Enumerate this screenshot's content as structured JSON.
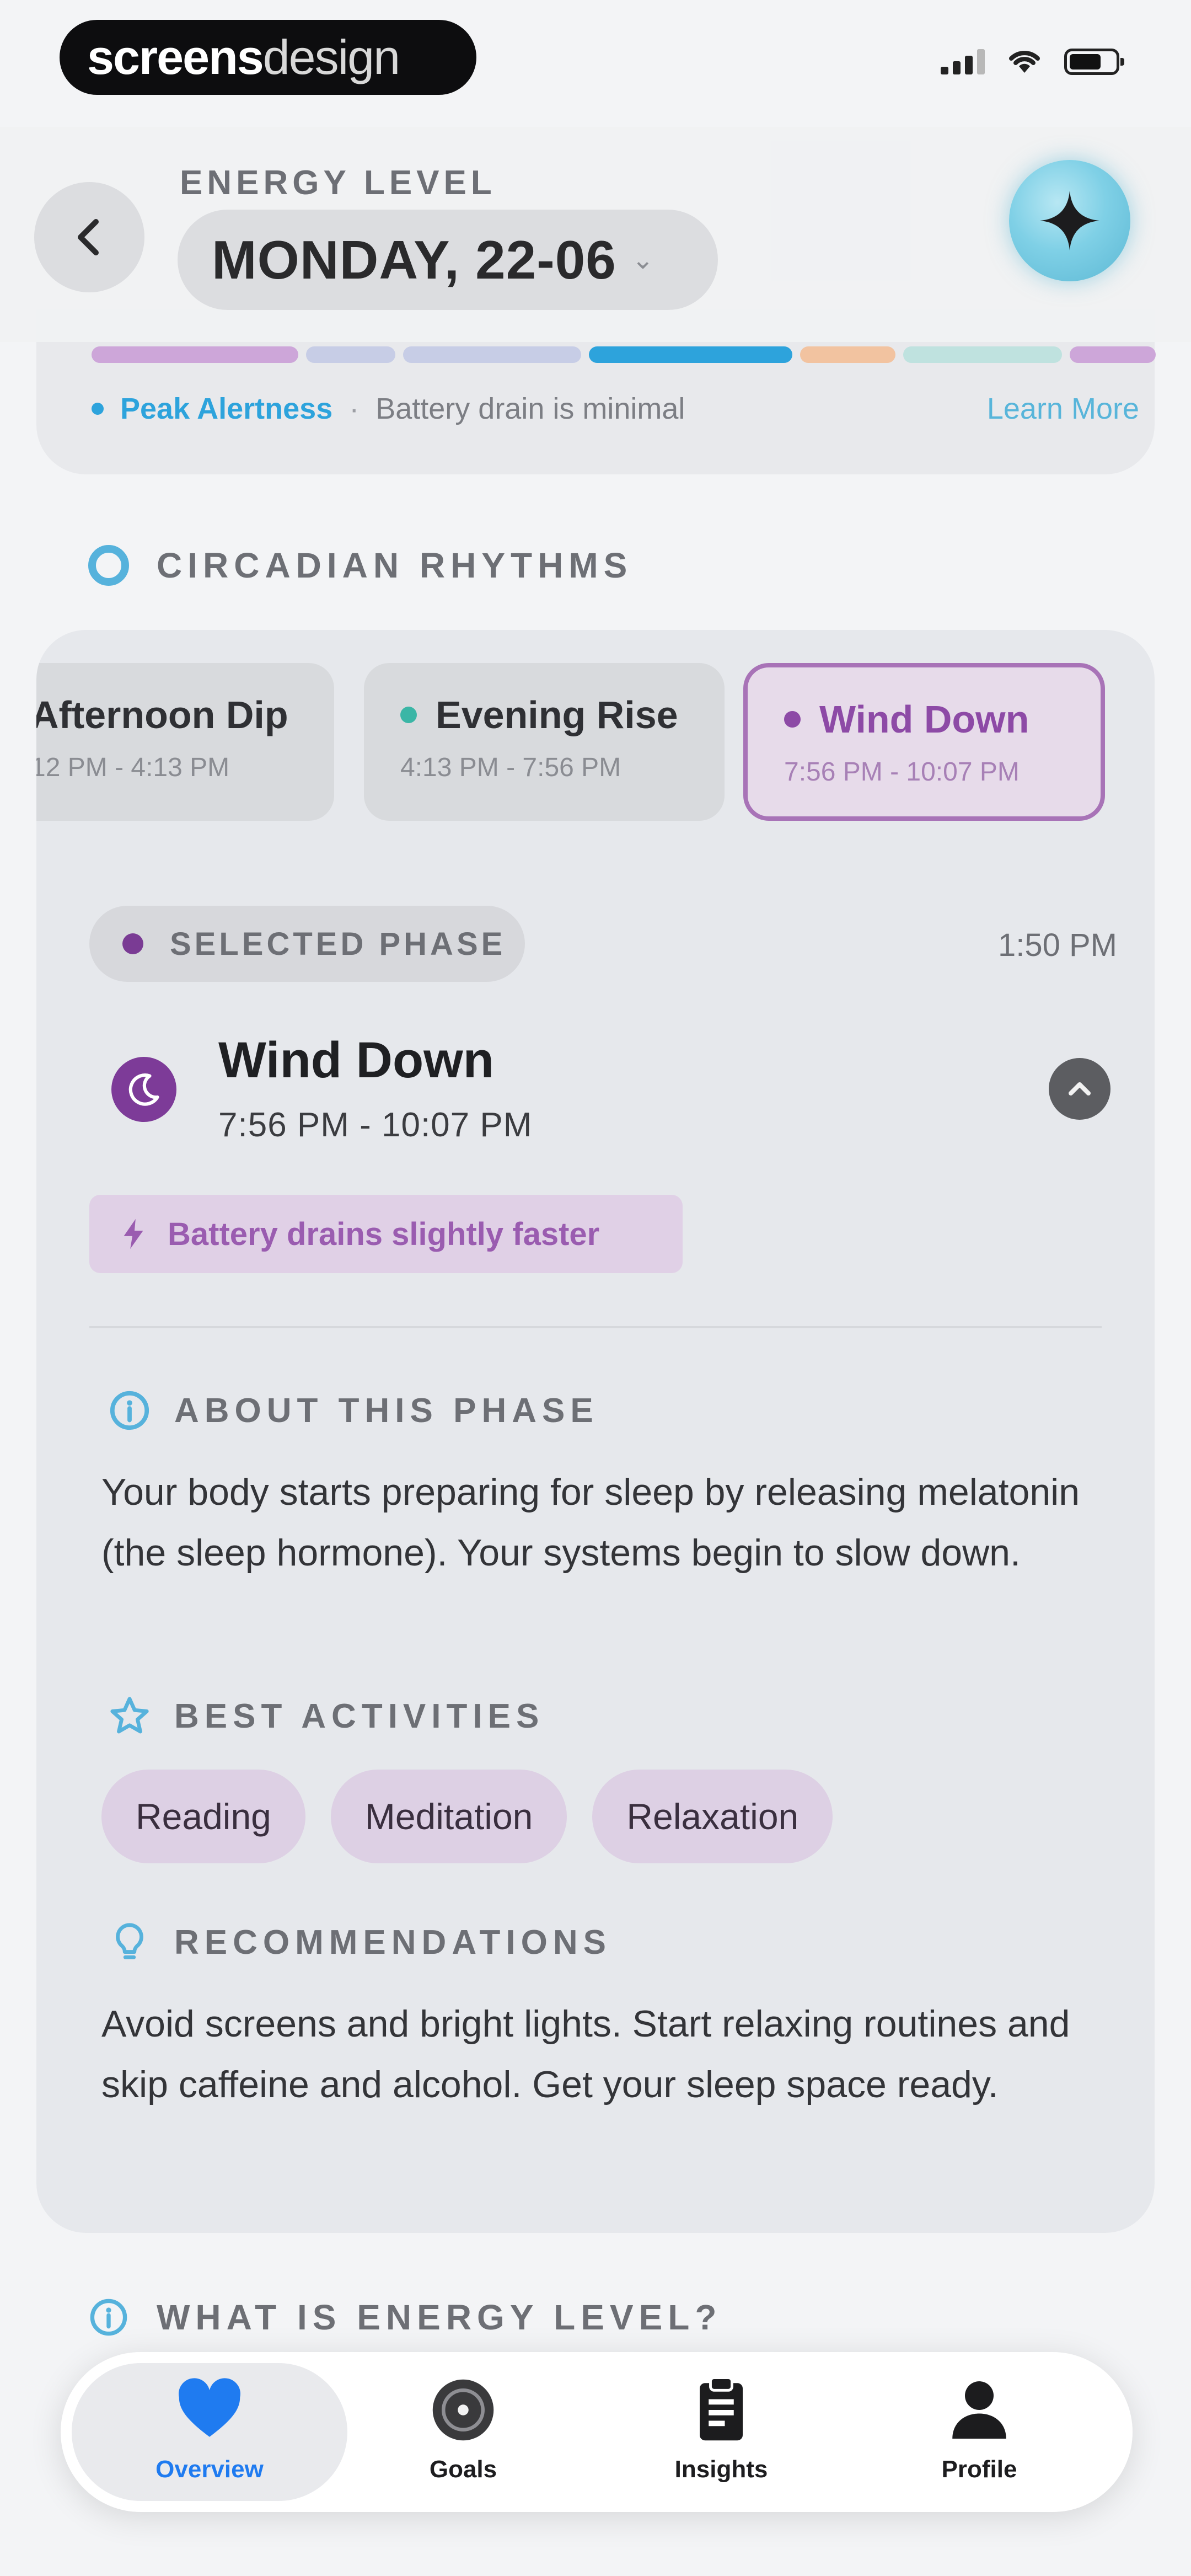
{
  "status_bar": {
    "brand_bold": "screens",
    "brand_light": "design"
  },
  "header": {
    "eyebrow": "ENERGY LEVEL",
    "date": "MONDAY, 22-06",
    "back_icon": "chevron-left-icon",
    "ai_icon": "sparkle-icon"
  },
  "summary": {
    "peak_label": "Peak Alertness",
    "separator": "·",
    "drain_text": "Battery drain is minimal",
    "learn_more": "Learn More",
    "energy_segments": [
      {
        "color": "#cda6d9",
        "fraction": 0.065
      },
      {
        "color": "#c7cde6",
        "fraction": 0.028
      },
      {
        "color": "#c7cde6",
        "fraction": 0.056
      },
      {
        "color": "#2da3dc",
        "fraction": 0.064
      },
      {
        "color": "#f2c3a0",
        "fraction": 0.03
      },
      {
        "color": "#bfe2df",
        "fraction": 0.05
      },
      {
        "color": "#cda6d9",
        "fraction": 0.027
      }
    ]
  },
  "circadian": {
    "section_label": "CIRCADIAN RHYTHMS",
    "phases": [
      {
        "name": "Afternoon Dip",
        "time": "12 PM - 4:13 PM",
        "dot": "",
        "selected": false
      },
      {
        "name": "Evening Rise",
        "time": "4:13 PM - 7:56 PM",
        "dot": "#3bb6a6",
        "selected": false
      },
      {
        "name": "Wind Down",
        "time": "7:56 PM - 10:07 PM",
        "dot": "#8d4aa6",
        "selected": true
      }
    ],
    "selected_badge": "SELECTED PHASE",
    "current_time": "1:50 PM",
    "selected": {
      "name": "Wind Down",
      "range": "7:56 PM - 10:07 PM",
      "drain_tag": "Battery drains slightly faster",
      "about_label": "ABOUT THIS PHASE",
      "about_text": "Your body starts preparing for sleep by releasing melatonin (the sleep hormone). Your systems begin to slow down.",
      "activities_label": "BEST ACTIVITIES",
      "activities": [
        "Reading",
        "Meditation",
        "Relaxation"
      ],
      "recommendations_label": "RECOMMENDATIONS",
      "recommendations_text": "Avoid screens and bright lights. Start relaxing routines and skip caffeine and alcohol. Get your sleep space ready."
    }
  },
  "what_is": {
    "section_label": "WHAT IS ENERGY LEVEL?"
  },
  "tab_bar": {
    "tabs": [
      {
        "label": "Overview",
        "icon": "heart-icon",
        "active": true
      },
      {
        "label": "Goals",
        "icon": "target-icon",
        "active": false
      },
      {
        "label": "Insights",
        "icon": "clipboard-icon",
        "active": false
      },
      {
        "label": "Profile",
        "icon": "person-icon",
        "active": false
      }
    ]
  },
  "colors": {
    "accent_blue": "#2da3dc",
    "phase_purple": "#7d3b98",
    "tab_active": "#1f7bf0"
  }
}
